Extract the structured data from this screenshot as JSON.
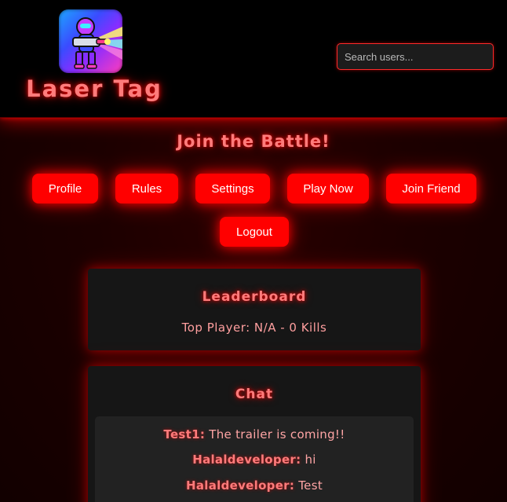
{
  "header": {
    "logo_icon": "laser-gun-robot-icon",
    "title": "Laser Tag",
    "search": {
      "placeholder": "Search users...",
      "value": ""
    }
  },
  "main": {
    "heading": "Join the Battle!",
    "buttons": [
      {
        "label": "Profile"
      },
      {
        "label": "Rules"
      },
      {
        "label": "Settings"
      },
      {
        "label": "Play Now"
      },
      {
        "label": "Join Friend"
      },
      {
        "label": "Logout"
      }
    ]
  },
  "leaderboard": {
    "title": "Leaderboard",
    "top_player": "Top Player: N/A - 0 Kills"
  },
  "chat": {
    "title": "Chat",
    "messages": [
      {
        "user": "Test1:",
        "text": "The trailer is coming!!"
      },
      {
        "user": "Halaldeveloper:",
        "text": "hi"
      },
      {
        "user": "Halaldeveloper:",
        "text": "Test"
      }
    ]
  },
  "colors": {
    "accent": "#ff0000",
    "heading": "#ff7b7b",
    "background": "#1c0000",
    "card": "#161616"
  }
}
